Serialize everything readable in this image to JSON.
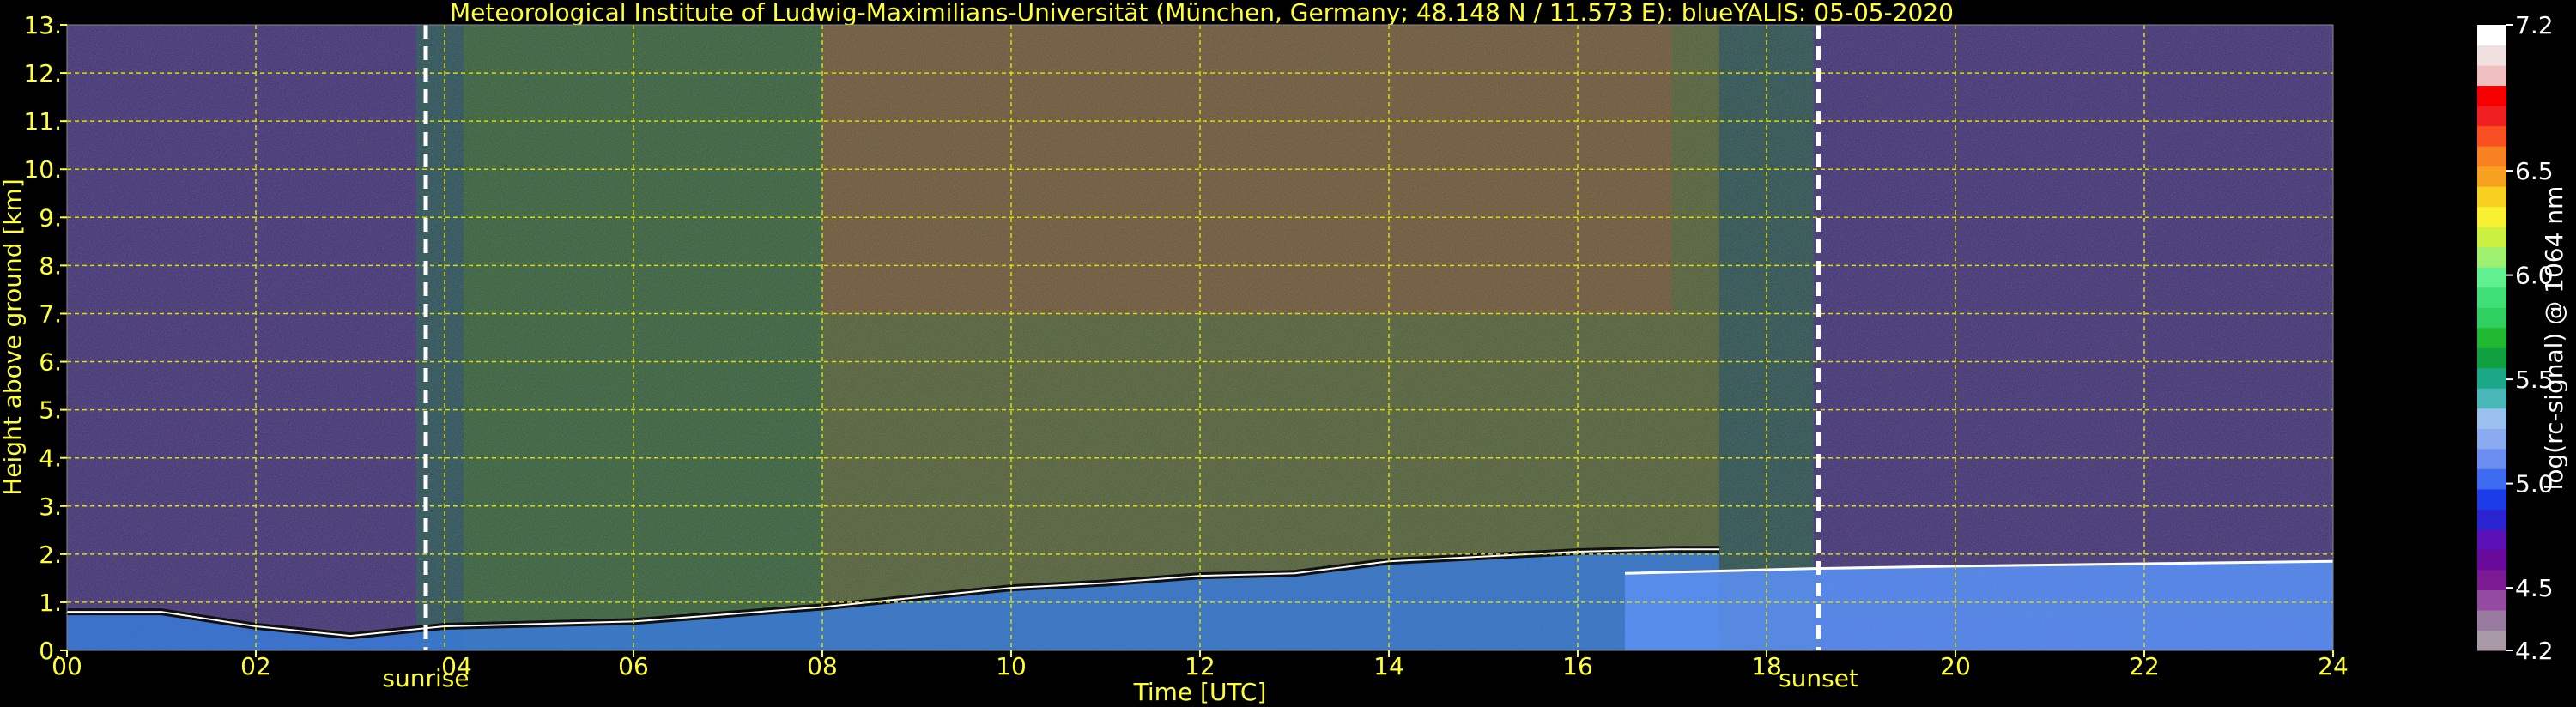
{
  "chart_data": {
    "type": "heatmap",
    "title": "Meteorological Institute of Ludwig-Maximilians-Universität (München, Germany; 48.148 N / 11.573 E):     blueYALIS: 05-05-2020",
    "xlabel": "Time [UTC]",
    "ylabel": "Height above ground [km]",
    "xlim": [
      0,
      24
    ],
    "ylim": [
      0,
      13
    ],
    "x_ticks": [
      {
        "value": 0,
        "label": "00"
      },
      {
        "value": 2,
        "label": "02"
      },
      {
        "value": 6,
        "label": "06"
      },
      {
        "value": 8,
        "label": "08"
      },
      {
        "value": 10,
        "label": "10"
      },
      {
        "value": 12,
        "label": "12"
      },
      {
        "value": 14,
        "label": "14"
      },
      {
        "value": 16,
        "label": "16"
      },
      {
        "value": 18,
        "label": "18"
      },
      {
        "value": 20,
        "label": "20"
      },
      {
        "value": 22,
        "label": "22"
      },
      {
        "value": 24,
        "label": "24"
      }
    ],
    "x_tick_partial": {
      "value": 4,
      "label": "04"
    },
    "y_ticks": [
      "0.",
      "1.",
      "2.",
      "3.",
      "4.",
      "5.",
      "6.",
      "7.",
      "8.",
      "9.",
      "10.",
      "11.",
      "12.",
      "13."
    ],
    "grid": true,
    "annotations": [
      {
        "label": "sunrise",
        "x": 3.8
      },
      {
        "label": "sunset",
        "x": 18.55
      }
    ],
    "colorbar": {
      "label": "log(rc-signal) @ 1064 nm",
      "range": [
        4.2,
        7.2
      ],
      "ticks": [
        {
          "value": 4.2,
          "label": "4.2"
        },
        {
          "value": 4.5,
          "label": "4.5"
        },
        {
          "value": 5.0,
          "label": "5.0"
        },
        {
          "value": 5.5,
          "label": "5.5"
        },
        {
          "value": 6.0,
          "label": "6.0"
        },
        {
          "value": 6.5,
          "label": "6.5"
        },
        {
          "value": 7.2,
          "label": "7.2"
        }
      ],
      "colors": [
        "#a89aa6",
        "#9a7aa0",
        "#944aa0",
        "#7c1a94",
        "#6a0a9a",
        "#5a10b4",
        "#2a24d0",
        "#1b3ce8",
        "#3e6cf0",
        "#6c8ef0",
        "#8caaf0",
        "#9ac0f0",
        "#4ab8b8",
        "#1aa888",
        "#10a040",
        "#20b830",
        "#30d060",
        "#40e078",
        "#60f090",
        "#a0f070",
        "#ccf040",
        "#f8f030",
        "#f8d020",
        "#f8a020",
        "#f88020",
        "#f85020",
        "#f02020",
        "#f80000",
        "#f0c0c0",
        "#f0e0e0",
        "#ffffff"
      ]
    },
    "boundary_layer_top_km": {
      "x": [
        0,
        1,
        2,
        3,
        4,
        6,
        8,
        10,
        11,
        12,
        13,
        14,
        15,
        16,
        17,
        17.5
      ],
      "y": [
        0.8,
        0.8,
        0.5,
        0.3,
        0.5,
        0.6,
        0.9,
        1.3,
        1.4,
        1.55,
        1.6,
        1.85,
        1.95,
        2.05,
        2.1,
        2.1
      ]
    },
    "residual_layer_top_km": {
      "x": [
        16.5,
        18.5,
        20,
        22,
        24
      ],
      "y": [
        1.6,
        1.7,
        1.75,
        1.8,
        1.85
      ]
    }
  }
}
